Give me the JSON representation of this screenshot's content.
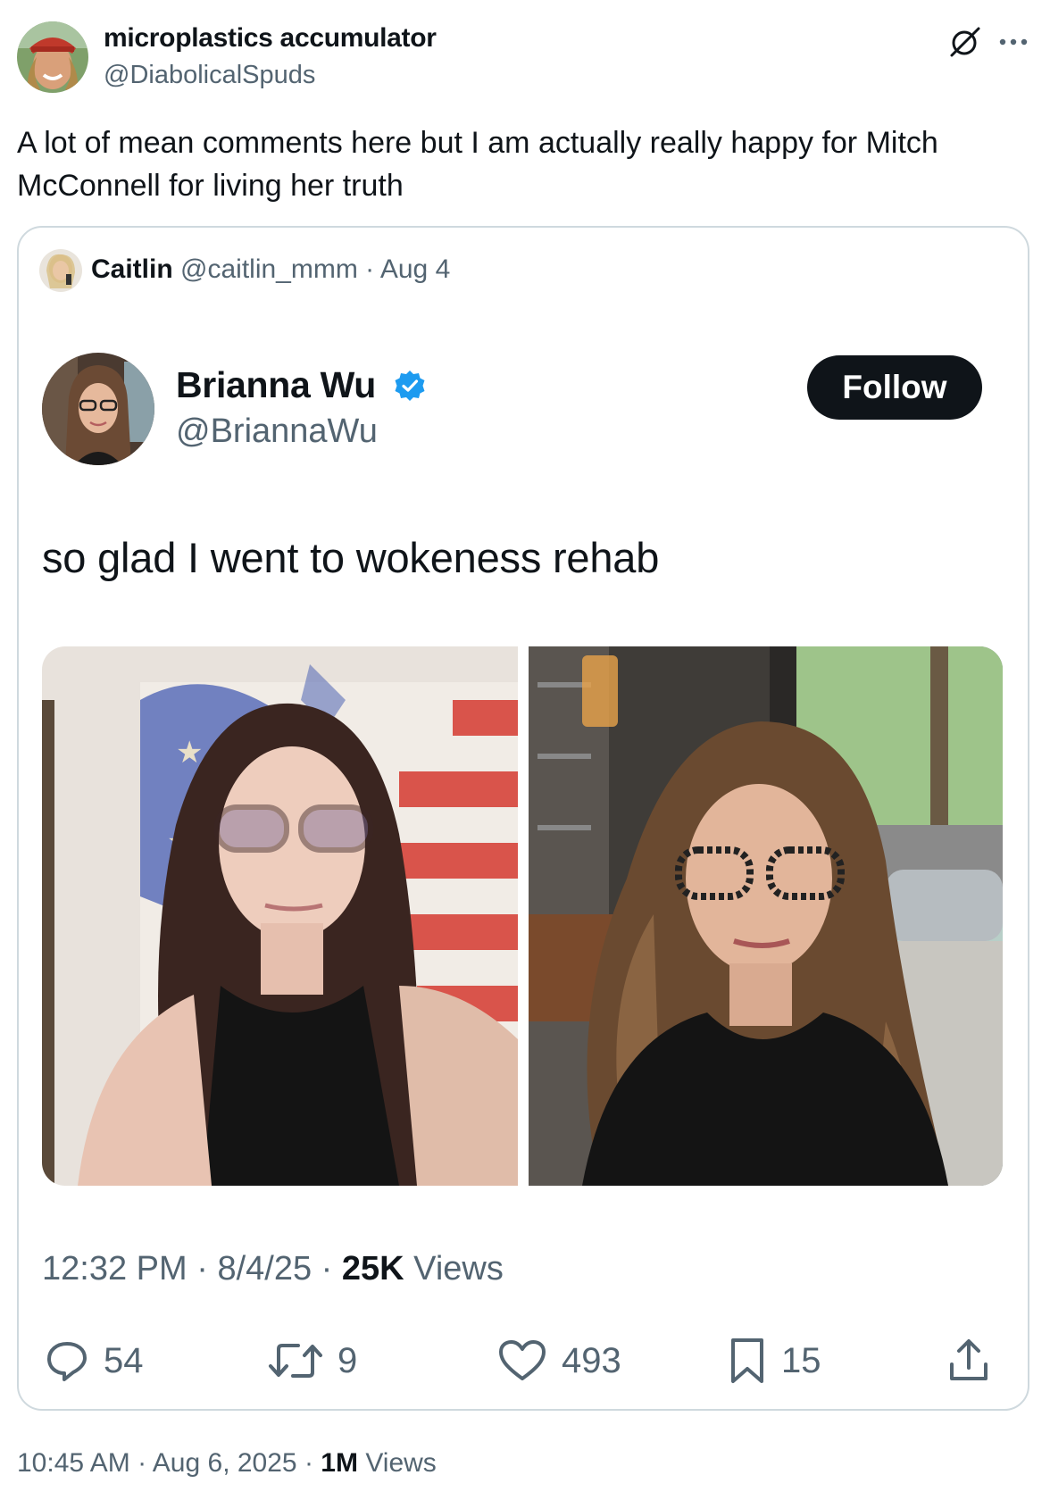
{
  "tweet": {
    "display_name": "microplastics accumulator",
    "handle": "@DiabolicalSpuds",
    "text": "A lot of mean comments here but I am actually really happy for Mitch McConnell for living her truth",
    "time": "10:45 AM",
    "date": "Aug 6, 2025",
    "views_count": "1M",
    "views_label": "Views"
  },
  "quote": {
    "name": "Caitlin",
    "handle": "@caitlin_mmm",
    "date": "Aug 4"
  },
  "embedded": {
    "name": "Brianna Wu",
    "handle": "@BriannaWu",
    "follow_label": "Follow",
    "text": "so glad I went to wokeness rehab",
    "time": "12:32 PM",
    "date": "8/4/25",
    "views_count": "25K",
    "views_label": "Views",
    "replies": "54",
    "reposts": "9",
    "likes": "493",
    "bookmarks": "15"
  },
  "sep": "·",
  "colors": {
    "text": "#0f1419",
    "secondary": "#536471",
    "verified": "#1d9bf0",
    "border": "#cfd9de"
  }
}
